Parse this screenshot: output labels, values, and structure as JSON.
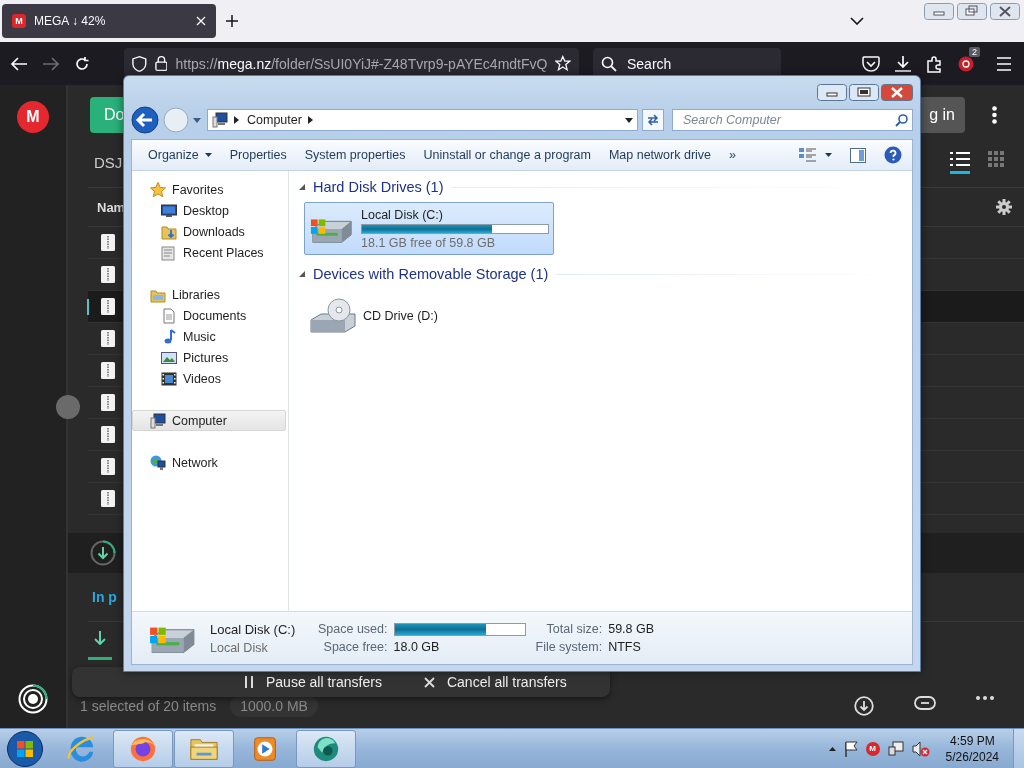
{
  "browser": {
    "tab": {
      "icon_letter": "M",
      "title": "MEGA ↓ 42%",
      "selected": true
    },
    "url": {
      "scheme": "https://",
      "domain": "mega.nz",
      "path": "/folder/SsUI0YiJ#-Z48Tvrp9-pAYEc4mdtFvQ"
    },
    "search": {
      "placeholder": "Search"
    },
    "extension_badge": "2"
  },
  "mega": {
    "logo": "M",
    "upload_button": "Do",
    "folder_name": "DSJ",
    "column_1": "Nam",
    "login_button": "g in",
    "views": [
      {
        "kind": "list",
        "selected": true
      },
      {
        "kind": "grid",
        "selected": false
      }
    ],
    "rows": [
      {
        "selected": false
      },
      {
        "selected": false
      },
      {
        "selected": true
      },
      {
        "selected": false
      },
      {
        "selected": false
      },
      {
        "selected": false
      },
      {
        "selected": false
      },
      {
        "selected": false
      },
      {
        "selected": false
      }
    ],
    "transfers": {
      "tab": "In p",
      "pause": "Pause all transfers",
      "cancel": "Cancel all transfers"
    },
    "status": {
      "selection": "1 selected of 20 items",
      "size": "1000.0 MB"
    }
  },
  "explorer": {
    "address": [
      "Computer"
    ],
    "search": {
      "placeholder": "Search Computer"
    },
    "commands": [
      {
        "label": "Organize",
        "kind": "menu"
      },
      {
        "label": "Properties",
        "kind": "plain"
      },
      {
        "label": "System properties",
        "kind": "plain"
      },
      {
        "label": "Uninstall or change a program",
        "kind": "plain"
      },
      {
        "label": "Map network drive",
        "kind": "plain"
      },
      {
        "label": "»",
        "kind": "plain"
      }
    ],
    "nav": [
      {
        "label": "Favorites",
        "kind": "star",
        "selected": false,
        "children": [
          {
            "label": "Desktop",
            "kind": "desktop",
            "selected": false
          },
          {
            "label": "Downloads",
            "kind": "downloads",
            "selected": false
          },
          {
            "label": "Recent Places",
            "kind": "recent",
            "selected": false
          }
        ]
      },
      {
        "label": "Libraries",
        "kind": "libraries",
        "selected": false,
        "children": [
          {
            "label": "Documents",
            "kind": "documents",
            "selected": false
          },
          {
            "label": "Music",
            "kind": "music",
            "selected": false
          },
          {
            "label": "Pictures",
            "kind": "pictures",
            "selected": false
          },
          {
            "label": "Videos",
            "kind": "videos",
            "selected": false
          }
        ]
      },
      {
        "label": "Computer",
        "kind": "computer",
        "selected": true
      },
      {
        "label": "Network",
        "kind": "network",
        "selected": false
      }
    ],
    "groups": [
      {
        "label": "Hard Disk Drives (1)",
        "items": [
          {
            "name": "Local Disk (C:)",
            "kind": "disk",
            "level": 0.7,
            "info": "18.1 GB free of 59.8 GB",
            "selected": true
          }
        ]
      },
      {
        "label": "Devices with Removable Storage (1)",
        "items": [
          {
            "name": "CD Drive (D:)",
            "kind": "cd",
            "selected": false
          }
        ]
      }
    ],
    "details": {
      "name": "Local Disk (C:)",
      "type": "Local Disk",
      "used_label": "Space used:",
      "level": 0.7,
      "free_label": "Space free:",
      "free": "18.0 GB",
      "total_label": "Total size:",
      "total": "59.8 GB",
      "fs_label": "File system:",
      "fs": "NTFS"
    }
  },
  "taskbar": {
    "apps": [
      {
        "kind": "ie",
        "running": false
      },
      {
        "kind": "firefox",
        "running": true
      },
      {
        "kind": "explorer",
        "running": true
      },
      {
        "kind": "media",
        "running": false
      },
      {
        "kind": "app",
        "running": true
      }
    ],
    "tray_letter": "M",
    "clock": {
      "time": "4:59 PM",
      "date": "5/26/2024"
    }
  }
}
